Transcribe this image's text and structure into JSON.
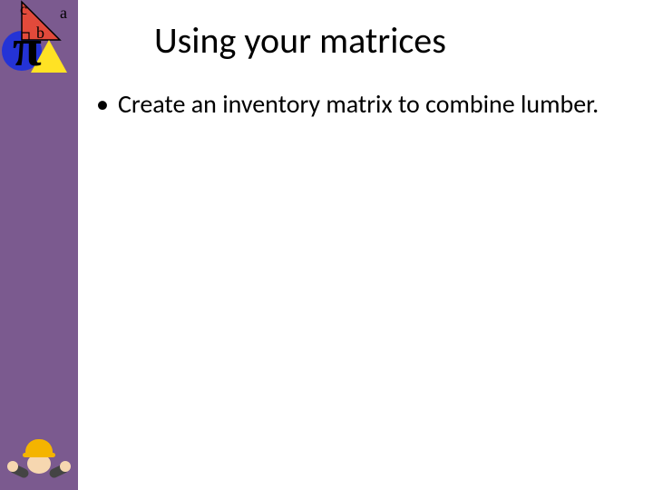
{
  "logo": {
    "label_c": "c",
    "label_a": "a",
    "label_b": "b",
    "pi": "π"
  },
  "slide": {
    "title": "Using your matrices",
    "bullets": [
      "Create an inventory matrix to combine lumber."
    ]
  }
}
